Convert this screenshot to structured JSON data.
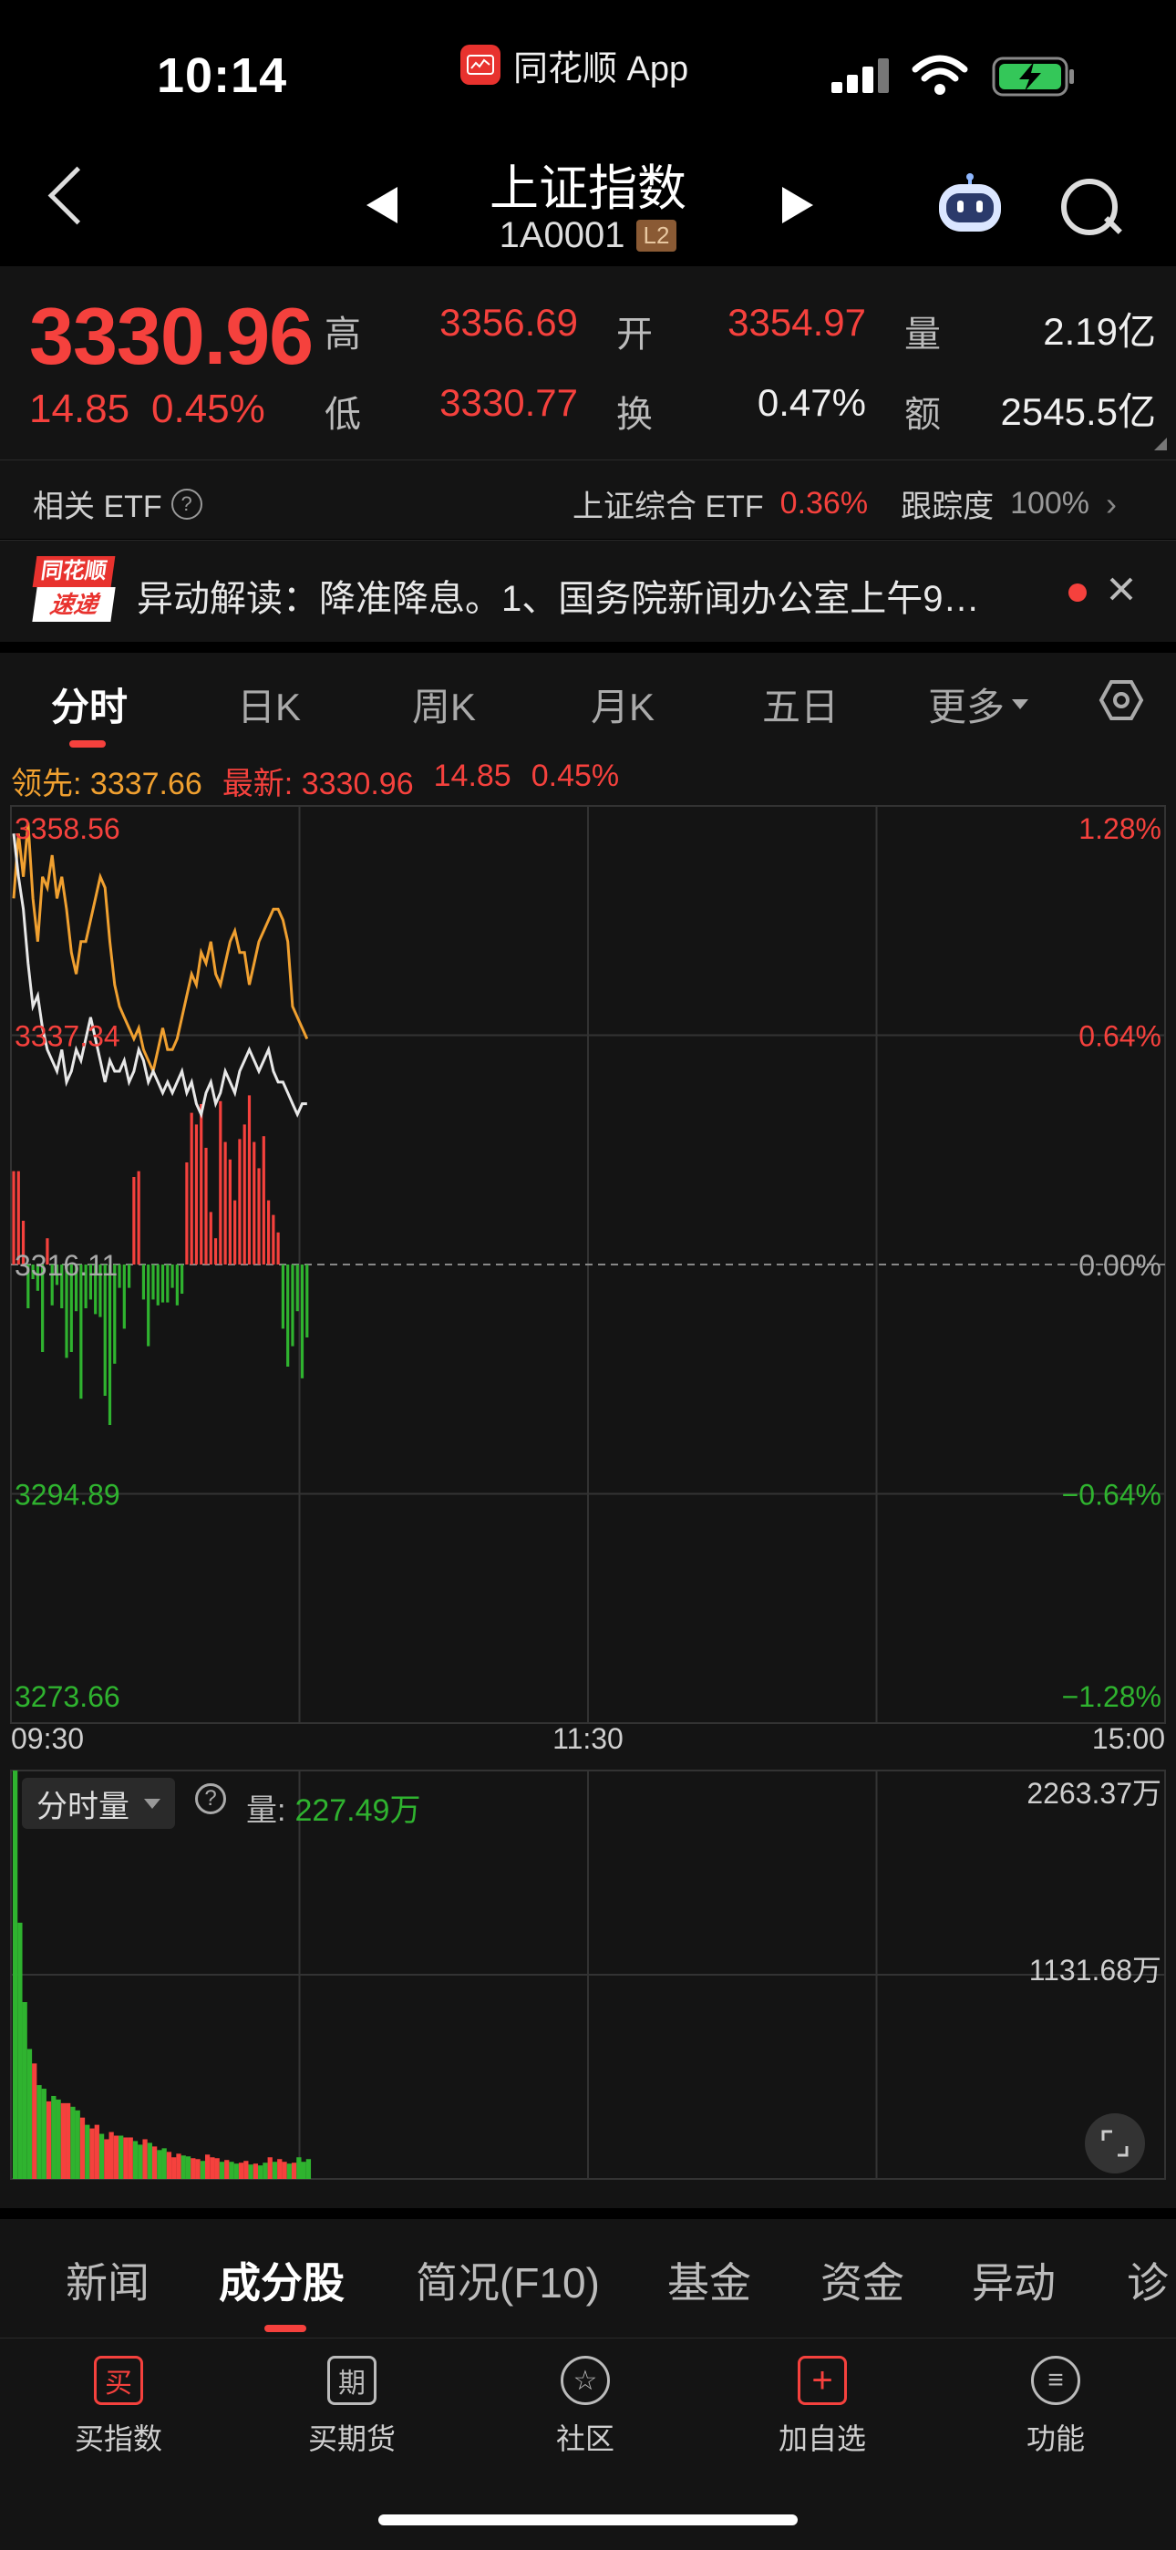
{
  "status_bar": {
    "time": "10:14",
    "app": "同花顺 App"
  },
  "nav": {
    "title": "上证指数",
    "code": "1A0001",
    "level_badge": "L2"
  },
  "quote": {
    "price": "3330.96",
    "change": "14.85",
    "change_pct": "0.45%",
    "high_label": "高",
    "high": "3356.69",
    "low_label": "低",
    "low": "3330.77",
    "open_label": "开",
    "open": "3354.97",
    "turnover_label": "换",
    "turnover": "0.47%",
    "volume_label": "量",
    "volume": "2.19亿",
    "amount_label": "额",
    "amount": "2545.5亿"
  },
  "etf": {
    "label": "相关 ETF",
    "name": "上证综合 ETF",
    "change": "0.36%",
    "tracking_label": "跟踪度",
    "tracking": "100%"
  },
  "news": {
    "badge_top": "同花顺",
    "badge_bottom": "速递",
    "text": "异动解读：降准降息。1、国务院新闻办公室上午9…"
  },
  "chart_tabs": [
    "分时",
    "日K",
    "周K",
    "月K",
    "五日",
    "更多"
  ],
  "legend": {
    "lead_label": "领先:",
    "lead": "3337.66",
    "latest_label": "最新:",
    "latest": "3330.96",
    "change": "14.85",
    "change_pct": "0.45%"
  },
  "chart_data": [
    {
      "type": "line",
      "x_ticks": [
        "09:30",
        "11:30",
        "15:00"
      ],
      "y_ticks_left": [
        "3358.56",
        "3337.34",
        "3316.11",
        "3294.89",
        "3273.66"
      ],
      "y_ticks_right": [
        "1.28%",
        "0.64%",
        "0.00%",
        "-0.64%",
        "-1.28%"
      ],
      "ylim": [
        3273.66,
        3358.56
      ],
      "baseline": 3316.11,
      "series": [
        {
          "name": "领先",
          "color": "#f0a030",
          "values": [
            3350,
            3356,
            3352,
            3357,
            3350,
            3346,
            3352,
            3351,
            3354,
            3350,
            3352,
            3349,
            3345,
            3343,
            3346,
            3346,
            3348,
            3350,
            3352,
            3351,
            3346,
            3342,
            3340,
            3339,
            3338,
            3337,
            3338,
            3336,
            3335,
            3334,
            3336,
            3338,
            3336,
            3336,
            3337,
            3339,
            3341,
            3343,
            3342,
            3345,
            3344,
            3346,
            3343,
            3342,
            3344,
            3346,
            3347,
            3345,
            3345,
            3342,
            3344,
            3346,
            3347,
            3348,
            3349,
            3349,
            3348,
            3346,
            3340,
            3339,
            3338,
            3337
          ]
        },
        {
          "name": "最新",
          "color": "#e8e8e8",
          "values": [
            3356,
            3352,
            3349,
            3344,
            3340,
            3341,
            3338,
            3336,
            3335,
            3334,
            3336,
            3333,
            3334,
            3336,
            3335,
            3337,
            3339,
            3337,
            3335,
            3333,
            3335,
            3334,
            3334,
            3335,
            3333,
            3334,
            3336,
            3335,
            3333,
            3334,
            3333,
            3332,
            3333,
            3332,
            3333,
            3334,
            3332,
            3333,
            3331,
            3330,
            3332,
            3333,
            3331,
            3332,
            3334,
            3333,
            3332,
            3334,
            3335,
            3336,
            3335,
            3334,
            3335,
            3336,
            3334,
            3333,
            3333,
            3332,
            3331,
            3330,
            3331,
            3331
          ]
        }
      ],
      "bars": {
        "name": "多空",
        "values": [
          3.2,
          3.2,
          1.5,
          -1.5,
          -0.5,
          -0.9,
          -3,
          0.9,
          -1.4,
          -0.7,
          -1.5,
          -3.2,
          -3,
          -1.6,
          -4.6,
          -1.5,
          -1.2,
          -1.7,
          -1.8,
          -4.5,
          -5.5,
          -3.4,
          -0.8,
          -2.2,
          -0.8,
          3,
          3.2,
          -1.2,
          -2.8,
          -1.2,
          -1.4,
          -1.3,
          -1.3,
          -0.8,
          -1.4,
          -1,
          3.5,
          5.2,
          4.8,
          5.5,
          4,
          1.8,
          0.9,
          5.6,
          4.2,
          3.6,
          2.2,
          4.3,
          4.8,
          5.8,
          4.2,
          3.3,
          4.4,
          2.2,
          1.7,
          1.1,
          -2.2,
          -3.5,
          -2.8,
          -1.6,
          -3.9,
          -2.5
        ]
      }
    },
    {
      "type": "bar",
      "title": "分时量",
      "info_label": "量:",
      "info_value": "227.49万",
      "y_ticks_right": [
        "2263.37万",
        "1131.68万"
      ],
      "ylim": [
        0,
        2263.37
      ],
      "values": [
        2263,
        1420,
        980,
        720,
        640,
        520,
        500,
        430,
        460,
        440,
        420,
        420,
        400,
        380,
        340,
        300,
        280,
        300,
        250,
        220,
        260,
        240,
        240,
        230,
        230,
        210,
        190,
        220,
        200,
        180,
        160,
        170,
        150,
        120,
        140,
        130,
        125,
        115,
        110,
        100,
        135,
        120,
        115,
        95,
        105,
        95,
        85,
        90,
        100,
        80,
        85,
        75,
        90,
        120,
        95,
        110,
        95,
        85,
        90,
        120,
        95,
        110
      ],
      "colors": [
        "g",
        "g",
        "g",
        "g",
        "r",
        "g",
        "g",
        "r",
        "g",
        "g",
        "r",
        "r",
        "g",
        "g",
        "r",
        "g",
        "r",
        "r",
        "g",
        "r",
        "r",
        "r",
        "g",
        "r",
        "r",
        "g",
        "g",
        "r",
        "g",
        "r",
        "g",
        "g",
        "r",
        "r",
        "r",
        "g",
        "g",
        "r",
        "r",
        "g",
        "r",
        "r",
        "r",
        "g",
        "r",
        "g",
        "g",
        "r",
        "r",
        "g",
        "r",
        "g",
        "g",
        "r",
        "g",
        "r",
        "r",
        "g",
        "r",
        "g",
        "g",
        "g"
      ]
    }
  ],
  "bottom_tabs": [
    "新闻",
    "成分股",
    "简况(F10)",
    "基金",
    "资金",
    "异动",
    "诊"
  ],
  "dock": [
    {
      "icon": "买",
      "label": "买指数"
    },
    {
      "icon": "期",
      "label": "买期货"
    },
    {
      "icon": "☆",
      "label": "社区"
    },
    {
      "icon": "+",
      "label": "加自选"
    },
    {
      "icon": "≡",
      "label": "功能"
    }
  ],
  "colors": {
    "up": "#f5413d",
    "down": "#2fb32f",
    "accent": "#f0a030"
  }
}
